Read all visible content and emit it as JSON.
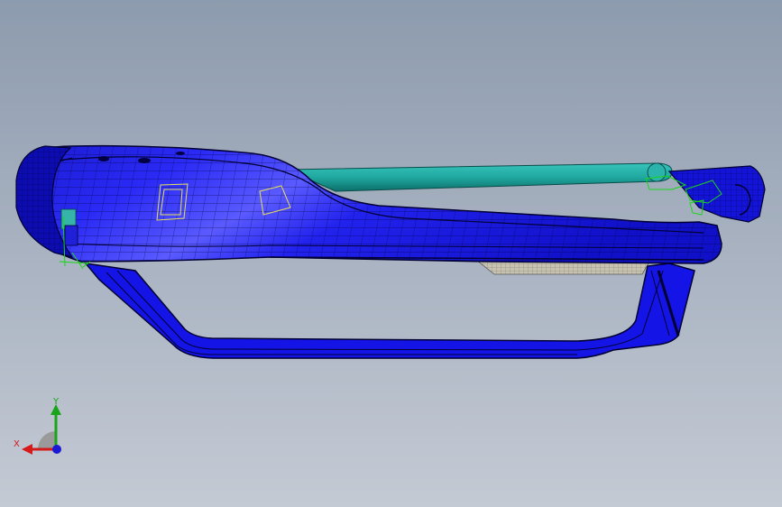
{
  "viewport": {
    "background_top": "#8d9bae",
    "background_bottom": "#c4cad4"
  },
  "model": {
    "primary_color": "#1414e6",
    "edge_color": "#000033",
    "rail_color": "#1fa8a0",
    "highlight_color": "#19d419",
    "tag_color": "#e6e05a",
    "inner_panel_color": "#c7c2b2"
  },
  "triad": {
    "y_label": "Y",
    "x_label": "X",
    "x_color": "#d41a1a",
    "y_color": "#1aa41a",
    "z_color": "#1a1ad4"
  }
}
